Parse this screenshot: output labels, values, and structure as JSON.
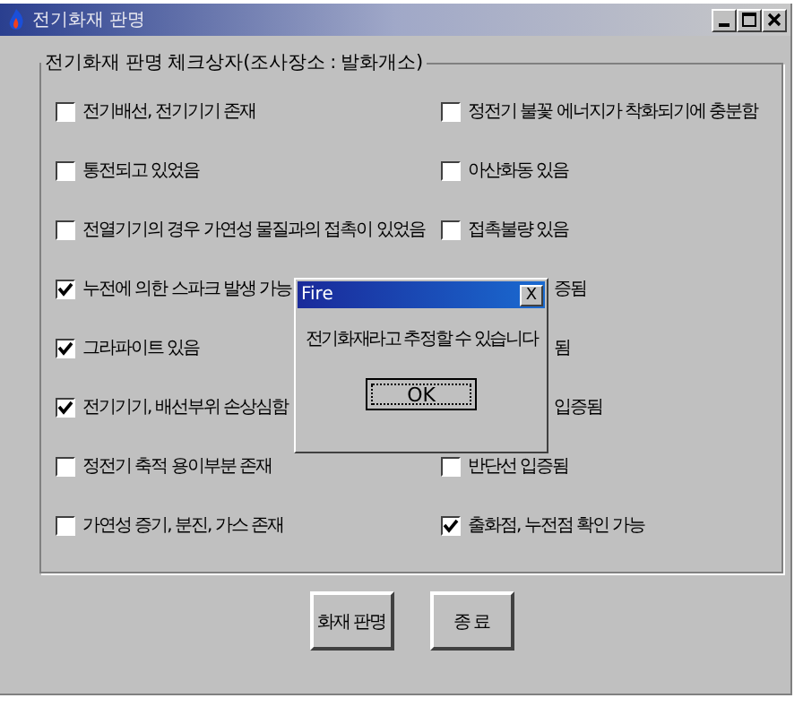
{
  "window": {
    "title": "전기화재 판명"
  },
  "group": {
    "title": "전기화재 판명 체크상자(조사장소 : 발화개소)"
  },
  "left_items": [
    {
      "kind": "full",
      "label": "전기배선, 전기기기 존재",
      "checked": false
    },
    {
      "kind": "full",
      "label": "통전되고 있었음",
      "checked": false
    },
    {
      "kind": "full",
      "label": "전열기기의 경우 가연성 물질과의 접촉이 있었음",
      "checked": false
    },
    {
      "kind": "full",
      "label": "누전에 의한 스파크 발생 가능",
      "checked": true
    },
    {
      "kind": "full",
      "label": "그라파이트 있음",
      "checked": true
    },
    {
      "kind": "full",
      "label": "전기기기, 배선부위 손상심함",
      "checked": true
    },
    {
      "kind": "full",
      "label": "정전기 축적 용이부분 존재",
      "checked": false
    },
    {
      "kind": "full",
      "label": "가연성 증기, 분진, 가스 존재",
      "checked": false
    }
  ],
  "right_items": [
    {
      "kind": "full",
      "label": "정전기 불꽃 에너지가 착화되기에 충분함",
      "checked": false
    },
    {
      "kind": "full",
      "label": "아산화동 있음",
      "checked": false
    },
    {
      "kind": "full",
      "label": "접촉불량 있음",
      "checked": false
    },
    {
      "kind": "partial",
      "label": "증됨"
    },
    {
      "kind": "partial",
      "label": "됨"
    },
    {
      "kind": "partial",
      "label": "입증됨"
    },
    {
      "kind": "full",
      "label": "반단선 입증됨",
      "checked": false
    },
    {
      "kind": "full",
      "label": "출화점, 누전점 확인 가능",
      "checked": true
    }
  ],
  "buttons": [
    "화재 판명",
    "종 료"
  ],
  "dialog": {
    "title": "Fire",
    "close": "X",
    "message": "전기화재라고 추정할 수 있습니다",
    "button": "OK"
  }
}
